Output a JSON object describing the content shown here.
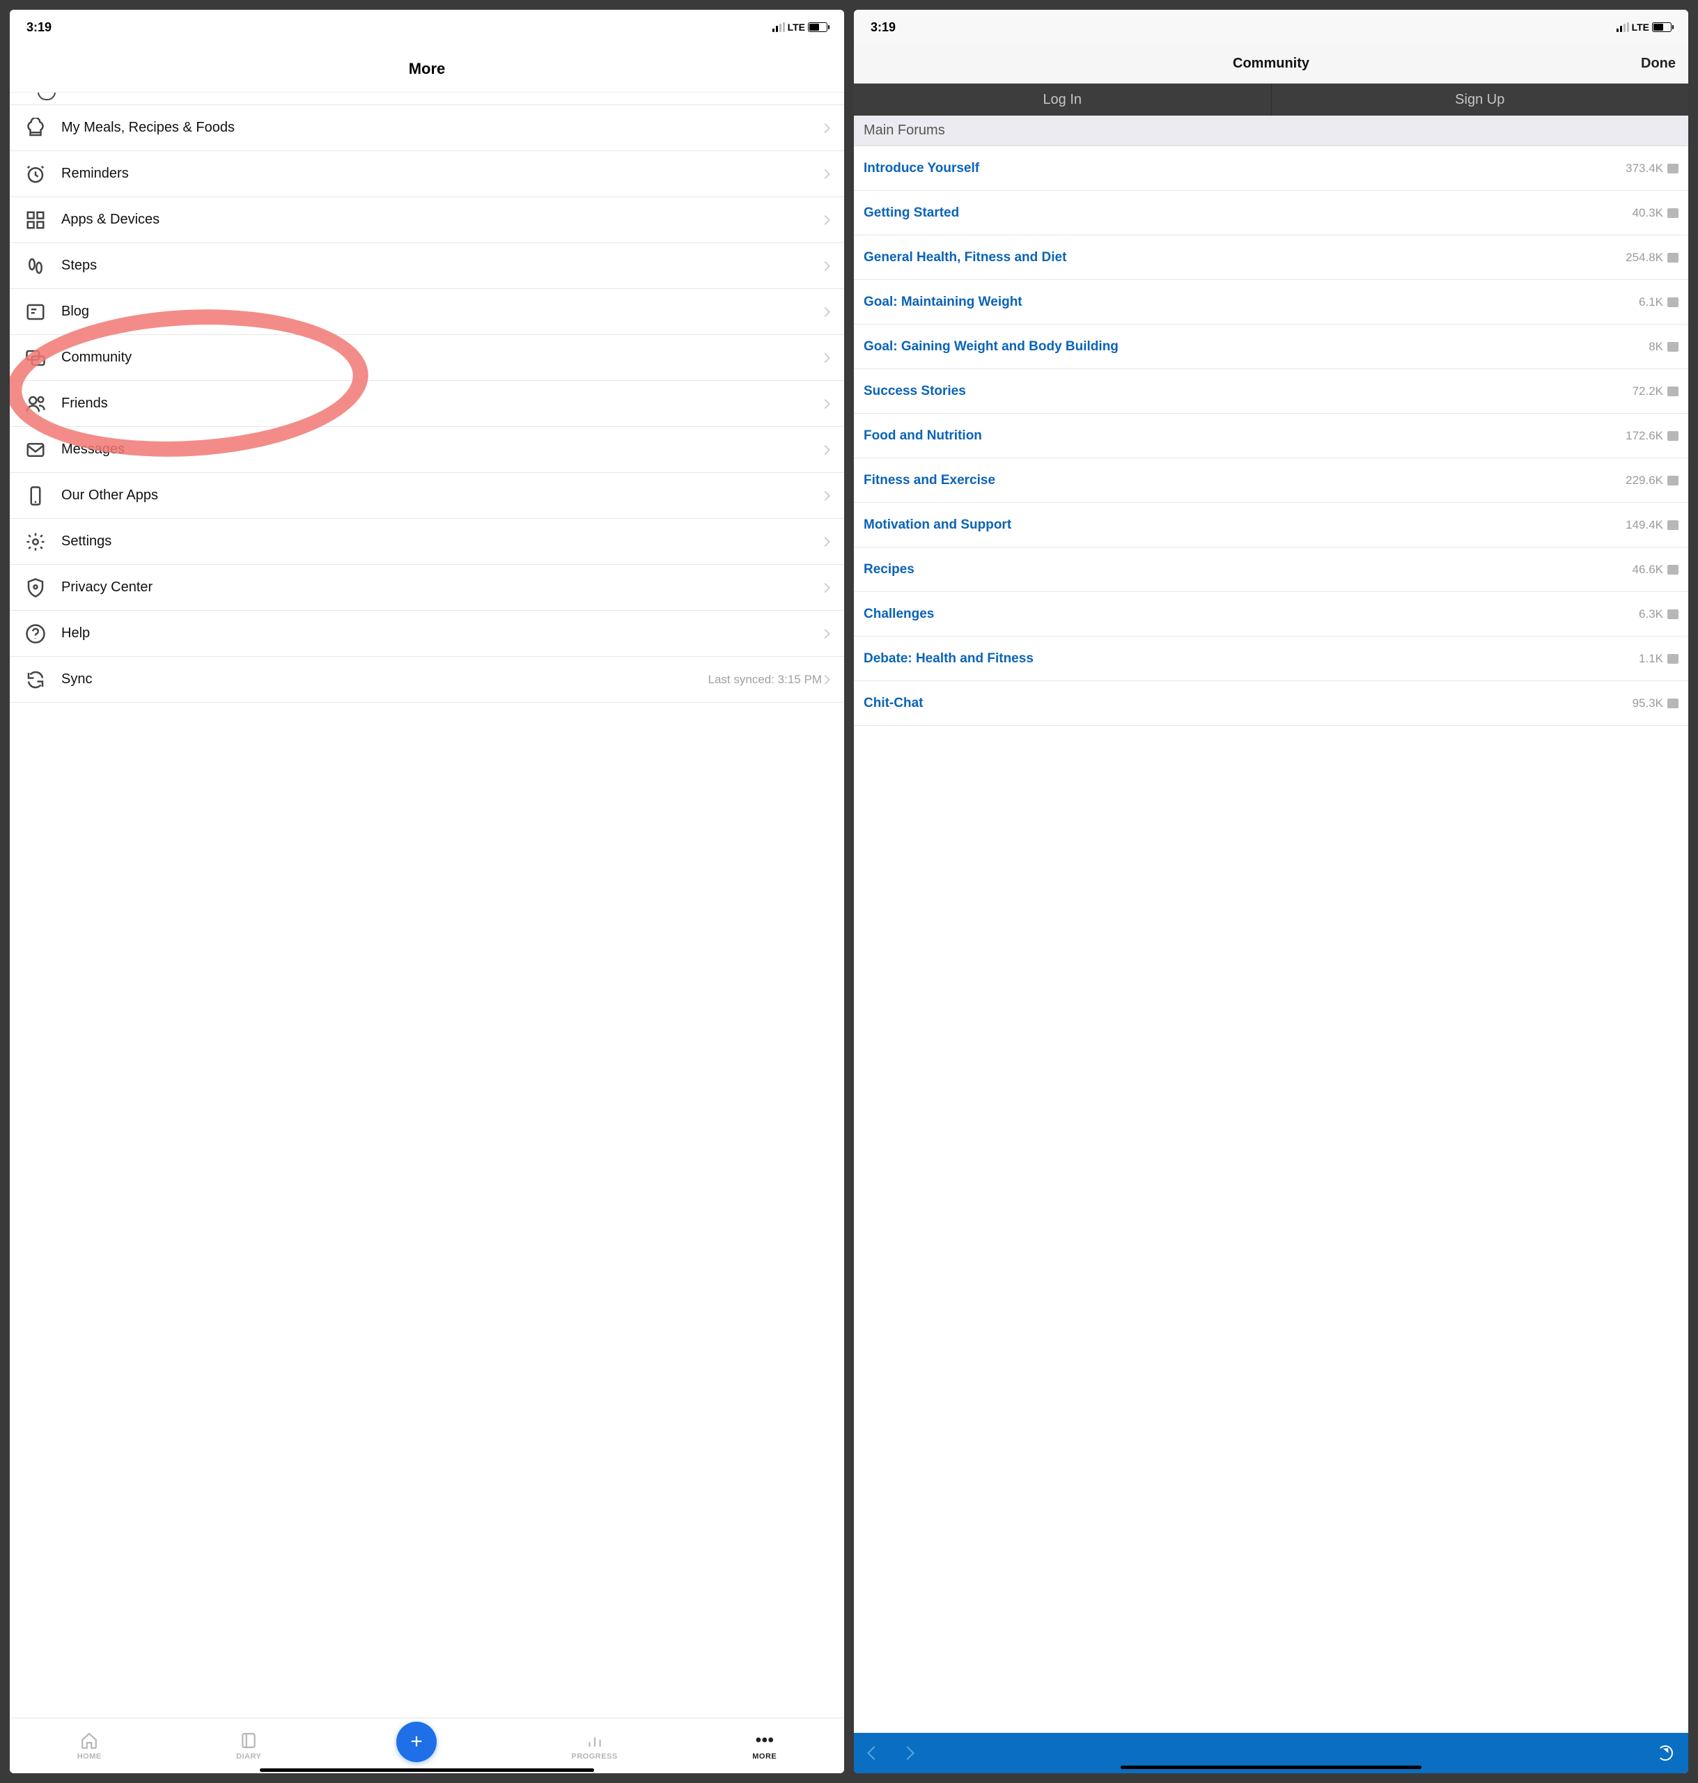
{
  "status": {
    "time": "3:19",
    "carrier": "LTE"
  },
  "left": {
    "header": "More",
    "rows": [
      {
        "icon": "chef-hat-icon",
        "label": "My Meals, Recipes & Foods"
      },
      {
        "icon": "clock-icon",
        "label": "Reminders"
      },
      {
        "icon": "grid-icon",
        "label": "Apps & Devices"
      },
      {
        "icon": "footsteps-icon",
        "label": "Steps"
      },
      {
        "icon": "news-icon",
        "label": "Blog"
      },
      {
        "icon": "forum-icon",
        "label": "Community"
      },
      {
        "icon": "friends-icon",
        "label": "Friends"
      },
      {
        "icon": "mail-icon",
        "label": "Messages"
      },
      {
        "icon": "phone-icon",
        "label": "Our Other Apps"
      },
      {
        "icon": "gear-icon",
        "label": "Settings"
      },
      {
        "icon": "shield-icon",
        "label": "Privacy Center"
      },
      {
        "icon": "help-icon",
        "label": "Help"
      },
      {
        "icon": "sync-icon",
        "label": "Sync",
        "sub": "Last synced: 3:15 PM"
      }
    ],
    "tabs": {
      "home": "HOME",
      "diary": "DIARY",
      "progress": "PROGRESS",
      "more": "MORE"
    }
  },
  "right": {
    "nav": {
      "title": "Community",
      "done": "Done"
    },
    "segtabs": {
      "login": "Log In",
      "signup": "Sign Up"
    },
    "section": "Main Forums",
    "forums": [
      {
        "name": "Introduce Yourself",
        "count": "373.4K"
      },
      {
        "name": "Getting Started",
        "count": "40.3K"
      },
      {
        "name": "General Health, Fitness and Diet",
        "count": "254.8K"
      },
      {
        "name": "Goal: Maintaining Weight",
        "count": "6.1K"
      },
      {
        "name": "Goal: Gaining Weight and Body Building",
        "count": "8K"
      },
      {
        "name": "Success Stories",
        "count": "72.2K"
      },
      {
        "name": "Food and Nutrition",
        "count": "172.6K"
      },
      {
        "name": "Fitness and Exercise",
        "count": "229.6K"
      },
      {
        "name": "Motivation and Support",
        "count": "149.4K"
      },
      {
        "name": "Recipes",
        "count": "46.6K"
      },
      {
        "name": "Challenges",
        "count": "6.3K"
      },
      {
        "name": "Debate: Health and Fitness",
        "count": "1.1K"
      },
      {
        "name": "Chit-Chat",
        "count": "95.3K"
      }
    ]
  }
}
